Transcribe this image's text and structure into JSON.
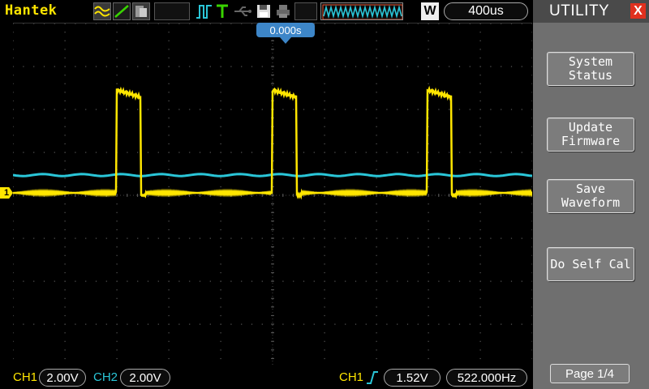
{
  "topbar": {
    "brand": "Hantek",
    "icons": [
      "average-mode-icon",
      "vector-mode-icon",
      "persist-mode-icon",
      "trigger-type-icon",
      "trigger-state-icon",
      "usb-icon",
      "save-icon",
      "print-icon"
    ],
    "wave_icon": "waveform-overview-icon",
    "mode_label": "W",
    "timebase": "400us"
  },
  "screen": {
    "trigger_position": "0.000s",
    "ch1_marker": "1",
    "colors": {
      "ch1": "#ffe600",
      "ch2": "#2ac6d8",
      "grid": "#5a5a5a"
    }
  },
  "bottombar": {
    "ch1_label": "CH1",
    "ch1_scale": "2.00V",
    "ch2_label": "CH2",
    "ch2_scale": "2.00V",
    "trig_label": "CH1",
    "trig_edge_icon": "rising-edge-icon",
    "trig_level": "1.52V",
    "frequency": "522.000Hz"
  },
  "menu": {
    "title": "UTILITY",
    "close": "X",
    "buttons": [
      {
        "label": "System\nStatus"
      },
      {
        "label": "Update\nFirmware"
      },
      {
        "label": "Save\nWaveform"
      },
      {
        "label": "Do Self Cal"
      }
    ],
    "page": "Page 1/4"
  }
}
